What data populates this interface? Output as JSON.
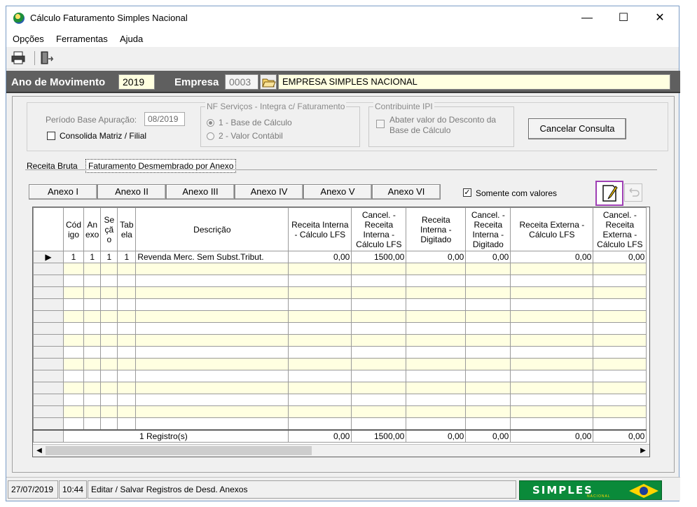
{
  "window": {
    "title": "Cálculo Faturamento Simples Nacional",
    "controls": {
      "minimize": "—",
      "maximize": "☐",
      "close": "✕"
    }
  },
  "menu": {
    "items": [
      "Opções",
      "Ferramentas",
      "Ajuda"
    ]
  },
  "toolbar": {
    "print_icon": "printer-icon",
    "exit_icon": "exit-door-icon"
  },
  "header": {
    "ano_label": "Ano de Movimento",
    "ano_value": "2019",
    "empresa_label": "Empresa",
    "empresa_code": "0003",
    "empresa_name": "EMPRESA SIMPLES NACIONAL"
  },
  "filters": {
    "periodo_label": "Período Base Apuração:",
    "periodo_value": "08/2019",
    "consolida_label": "Consolida Matriz / Filial",
    "nf_group_title": "NF Serviços - Integra c/ Faturamento",
    "nf_option1": "1 -  Base de Cálculo",
    "nf_option2": "2 -  Valor Contábil",
    "ipi_group_title": "Contribuinte IPI",
    "ipi_option": "Abater valor do Desconto da Base de Cálculo",
    "cancel_button": "Cancelar Consulta"
  },
  "tabs": [
    "Receita Bruta",
    "Faturamento Desmembrado por Anexo"
  ],
  "annex_buttons": [
    "Anexo I",
    "Anexo II",
    "Anexo III",
    "Anexo IV",
    "Anexo V",
    "Anexo VI"
  ],
  "somente_label": "Somente com valores",
  "grid": {
    "columns": [
      "Cód igo",
      "An exo",
      "Se çã o",
      "Tab ela",
      "Descrição",
      "Receita Interna - Cálculo LFS",
      "Cancel. - Receita Interna - Cálculo LFS",
      "Receita Interna - Digitado",
      "Cancel. - Receita Interna - Digitado",
      "Receita Externa - Cálculo LFS",
      "Cancel. - Receita Externa - Cálculo LFS"
    ],
    "rows": [
      [
        "1",
        "1",
        "1",
        "1",
        "Revenda Merc. Sem Subst.Tribut.",
        "0,00",
        "1500,00",
        "0,00",
        "0,00",
        "0,00",
        "0,00"
      ]
    ],
    "footer": {
      "count": "1 Registro(s)",
      "totals": [
        "0,00",
        "1500,00",
        "0,00",
        "0,00",
        "0,00",
        "0,00"
      ]
    }
  },
  "status": {
    "date": "27/07/2019",
    "time": "10:44",
    "message": "Editar / Salvar Registros de Desd. Anexos",
    "logo": "SIMPLES",
    "logo_sub": "NACIONAL"
  }
}
